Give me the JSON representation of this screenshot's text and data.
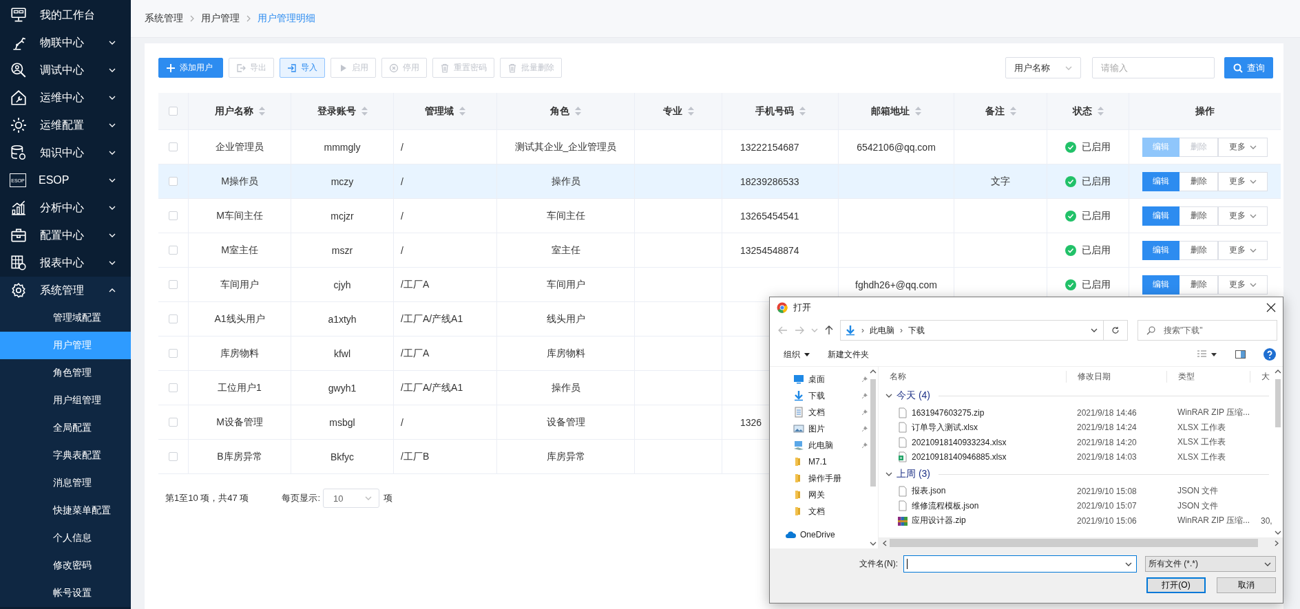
{
  "sidebar": {
    "items": [
      {
        "label": "我的工作台",
        "kind": "link"
      },
      {
        "label": "物联中心",
        "kind": "group",
        "expanded": false
      },
      {
        "label": "调试中心",
        "kind": "group",
        "expanded": false
      },
      {
        "label": "运维中心",
        "kind": "group",
        "expanded": false
      },
      {
        "label": "运维配置",
        "kind": "group",
        "expanded": false
      },
      {
        "label": "知识中心",
        "kind": "group",
        "expanded": false
      },
      {
        "label": "ESOP",
        "kind": "group",
        "expanded": false,
        "badge": "ESOP"
      },
      {
        "label": "分析中心",
        "kind": "group",
        "expanded": false
      },
      {
        "label": "配置中心",
        "kind": "group",
        "expanded": false
      },
      {
        "label": "报表中心",
        "kind": "group",
        "expanded": false
      },
      {
        "label": "系统管理",
        "kind": "group",
        "expanded": true,
        "children": [
          {
            "label": "管理域配置",
            "selected": false
          },
          {
            "label": "用户管理",
            "selected": true
          },
          {
            "label": "角色管理",
            "selected": false
          },
          {
            "label": "用户组管理",
            "selected": false
          },
          {
            "label": "全局配置",
            "selected": false
          },
          {
            "label": "字典表配置",
            "selected": false
          },
          {
            "label": "消息管理",
            "selected": false
          },
          {
            "label": "快捷菜单配置",
            "selected": false
          },
          {
            "label": "个人信息",
            "selected": false
          },
          {
            "label": "修改密码",
            "selected": false
          },
          {
            "label": "帐号设置",
            "selected": false
          }
        ]
      }
    ]
  },
  "breadcrumb": [
    {
      "label": "系统管理",
      "current": false
    },
    {
      "label": "用户管理",
      "current": false
    },
    {
      "label": "用户管理明细",
      "current": true
    }
  ],
  "toolbar": {
    "buttons": [
      {
        "label": "添加用户",
        "kind": "primary",
        "disabled": false
      },
      {
        "label": "导出",
        "kind": "default",
        "disabled": true
      },
      {
        "label": "导入",
        "kind": "light",
        "disabled": false
      },
      {
        "label": "启用",
        "kind": "default",
        "disabled": true
      },
      {
        "label": "停用",
        "kind": "default",
        "disabled": true
      },
      {
        "label": "重置密码",
        "kind": "default",
        "disabled": true
      },
      {
        "label": "批量删除",
        "kind": "default",
        "disabled": true
      }
    ],
    "search": {
      "field": "用户名称",
      "placeholder": "请输入",
      "button": "查询"
    }
  },
  "table": {
    "header_checked": false,
    "columns": [
      {
        "label": "用户名称",
        "sortable": true
      },
      {
        "label": "登录账号",
        "sortable": true
      },
      {
        "label": "管理域",
        "sortable": true
      },
      {
        "label": "角色",
        "sortable": true
      },
      {
        "label": "专业",
        "sortable": true
      },
      {
        "label": "手机号码",
        "sortable": true
      },
      {
        "label": "邮箱地址",
        "sortable": true
      },
      {
        "label": "备注",
        "sortable": true
      },
      {
        "label": "状态",
        "sortable": true
      },
      {
        "label": "操作",
        "sortable": false
      }
    ],
    "rows": [
      {
        "selected": false,
        "checked": false,
        "name": "企业管理员",
        "account": "mmmgly",
        "domain": "/",
        "role": "测试其企业_企业管理员",
        "phone": "13222154687",
        "email": "6542106@qq.com",
        "status": "已启用",
        "actions": {
          "edit": "编辑",
          "delete": "删除",
          "more": "更多",
          "disabled": true
        }
      },
      {
        "selected": true,
        "checked": false,
        "name": "M操作员",
        "account": "mczy",
        "domain": "/",
        "role": "操作员",
        "phone": "18239286533",
        "remark": "文字",
        "status": "已启用",
        "actions": {
          "edit": "编辑",
          "delete": "删除",
          "more": "更多",
          "disabled": false
        }
      },
      {
        "selected": false,
        "checked": false,
        "name": "M车间主任",
        "account": "mcjzr",
        "domain": "/",
        "role": "车间主任",
        "phone": "13265454541",
        "status": "已启用",
        "actions": {
          "edit": "编辑",
          "delete": "删除",
          "more": "更多",
          "disabled": false
        }
      },
      {
        "selected": false,
        "checked": false,
        "name": "M室主任",
        "account": "mszr",
        "domain": "/",
        "role": "室主任",
        "phone": "13254548874",
        "status": "已启用",
        "actions": {
          "edit": "编辑",
          "delete": "删除",
          "more": "更多",
          "disabled": false
        }
      },
      {
        "selected": false,
        "checked": false,
        "name": "车间用户",
        "account": "cjyh",
        "domain": "/工厂A",
        "role": "车间用户",
        "email": "fghdh26+@qq.com",
        "status": "已启用",
        "actions": {
          "edit": "编辑",
          "delete": "删除",
          "more": "更多",
          "disabled": false
        }
      },
      {
        "selected": false,
        "checked": false,
        "name": "A1线头用户",
        "account": "a1xtyh",
        "domain": "/工厂A/产线A1",
        "role": "线头用户"
      },
      {
        "selected": false,
        "checked": false,
        "name": "库房物料",
        "account": "kfwl",
        "domain": "/工厂A",
        "role": "库房物料"
      },
      {
        "selected": false,
        "checked": false,
        "name": "工位用户1",
        "account": "gwyh1",
        "domain": "/工厂A/产线A1",
        "role": "操作员"
      },
      {
        "selected": false,
        "checked": false,
        "name": "M设备管理",
        "account": "msbgl",
        "domain": "/",
        "role": "设备管理",
        "phone": "1326"
      },
      {
        "selected": false,
        "checked": false,
        "name": "B库房异常",
        "account": "Bkfyc",
        "domain": "/工厂B",
        "role": "库房异常"
      }
    ]
  },
  "pager": {
    "summary": "第1至10 项，共47 项",
    "per_page_label": "每页显示:",
    "per_page": "10",
    "unit": "项"
  },
  "dialog": {
    "title": "打开",
    "path": [
      "此电脑",
      "下载"
    ],
    "path_separator": "›",
    "search_placeholder": "搜索\"下载\"",
    "toolbar": [
      "组织",
      "新建文件夹"
    ],
    "nav": [
      {
        "label": "桌面",
        "kind": "desktop",
        "pinned": true
      },
      {
        "label": "下载",
        "kind": "downloads",
        "pinned": true
      },
      {
        "label": "文档",
        "kind": "documents",
        "pinned": true
      },
      {
        "label": "图片",
        "kind": "pictures",
        "pinned": true
      },
      {
        "label": "此电脑",
        "kind": "pc",
        "pinned": true
      },
      {
        "label": "M7.1",
        "kind": "folder",
        "pinned": false
      },
      {
        "label": "操作手册",
        "kind": "folder",
        "pinned": false
      },
      {
        "label": "网关",
        "kind": "folder",
        "pinned": false
      },
      {
        "label": "文档",
        "kind": "folder",
        "pinned": false
      },
      {
        "label": "OneDrive",
        "kind": "cloud",
        "pinned": false
      }
    ],
    "columns": [
      "名称",
      "修改日期",
      "类型",
      "大"
    ],
    "groups": [
      {
        "label": "今天 (4)",
        "expanded": true,
        "files": [
          {
            "name": "1631947603275.zip",
            "kind": "blank",
            "date": "2021/9/18 14:46",
            "type": "WinRAR ZIP 压缩..."
          },
          {
            "name": "订单导入测试.xlsx",
            "kind": "blank",
            "date": "2021/9/18 14:24",
            "type": "XLSX 工作表"
          },
          {
            "name": "20210918140933234.xlsx",
            "kind": "blank",
            "date": "2021/9/18 14:20",
            "type": "XLSX 工作表"
          },
          {
            "name": "20210918140946885.xlsx",
            "kind": "sheet",
            "date": "2021/9/18 14:03",
            "type": "XLSX 工作表"
          }
        ]
      },
      {
        "label": "上周 (3)",
        "expanded": true,
        "files": [
          {
            "name": "报表.json",
            "kind": "blank",
            "date": "2021/9/10 15:08",
            "type": "JSON 文件"
          },
          {
            "name": "维修流程模板.json",
            "kind": "blank",
            "date": "2021/9/10 15:07",
            "type": "JSON 文件"
          },
          {
            "name": "应用设计器.zip",
            "kind": "archive",
            "date": "2021/9/10 15:06",
            "type": "WinRAR ZIP 压缩...",
            "size": "30,"
          }
        ]
      }
    ],
    "filename_label": "文件名(N):",
    "filter": "所有文件 (*.*)",
    "buttons": [
      {
        "label": "打开(O)",
        "kind": "default"
      },
      {
        "label": "取消",
        "kind": "normal"
      }
    ]
  }
}
